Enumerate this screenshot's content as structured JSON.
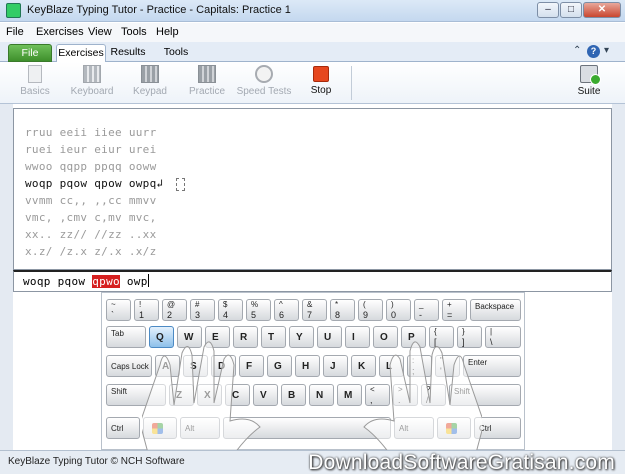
{
  "window": {
    "title": "KeyBlaze Typing Tutor - Practice - Capitals: Practice 1",
    "controls": {
      "minimize": "–",
      "maximize": "□",
      "close": "✕"
    }
  },
  "menu": [
    "File",
    "Exercises",
    "View",
    "Tools",
    "Help"
  ],
  "tabs": {
    "file": "File",
    "items": [
      "Exercises",
      "Results",
      "Tools"
    ],
    "active": "Exercises"
  },
  "ribbon": {
    "buttons": [
      {
        "label": "Basics",
        "icon": "basics-icon",
        "enabled": false
      },
      {
        "label": "Keyboard",
        "icon": "keyboard-icon",
        "enabled": false
      },
      {
        "label": "Keypad",
        "icon": "keypad-icon",
        "enabled": false
      },
      {
        "label": "Practice",
        "icon": "practice-icon",
        "enabled": false
      },
      {
        "label": "Speed Tests",
        "icon": "speed-test-icon",
        "enabled": false
      },
      {
        "label": "Stop",
        "icon": "stop-icon",
        "enabled": true
      }
    ],
    "suite": {
      "label": "Suite",
      "icon": "suite-icon",
      "enabled": true
    }
  },
  "practice": {
    "lines": [
      "rruu eeii iiee uurr",
      "ruei ieur eiur urei",
      "wwoo qqpp ppqq ooww",
      "woqp pqow qpow owpq",
      "vvmm cc,, ,,cc mmvv",
      "vmc, ,cmv c,mv mvc,",
      "xx.. zz// //zz ..xx",
      "x.z/ /z.x z/.x .x/z"
    ],
    "current_line": 3,
    "return_symbol": "↲"
  },
  "input": {
    "before": "woqp pqow ",
    "error": "qpwo",
    "after": " owp"
  },
  "keyboard": {
    "row1": [
      [
        "~",
        "`"
      ],
      [
        "!",
        "1"
      ],
      [
        "@",
        "2"
      ],
      [
        "#",
        "3"
      ],
      [
        "$",
        "4"
      ],
      [
        "%",
        "5"
      ],
      [
        "^",
        "6"
      ],
      [
        "&",
        "7"
      ],
      [
        "*",
        "8"
      ],
      [
        "(",
        "9"
      ],
      [
        ")",
        "0"
      ],
      [
        "_",
        "-"
      ],
      [
        "+",
        "="
      ]
    ],
    "row1_backspace": "Backspace",
    "tab": "Tab",
    "row2": [
      "Q",
      "W",
      "E",
      "R",
      "T",
      "Y",
      "U",
      "I",
      "O",
      "P"
    ],
    "row2_brackets": [
      [
        "{",
        "["
      ],
      [
        "}",
        "]"
      ],
      [
        "|",
        "\\"
      ]
    ],
    "caps": "Caps Lock",
    "row3": [
      "A",
      "S",
      "D",
      "F",
      "G",
      "H",
      "J",
      "K",
      "L"
    ],
    "row3_punct": [
      [
        ":",
        ";"
      ],
      [
        "\"",
        "'"
      ]
    ],
    "enter": "Enter",
    "shift_left": "Shift",
    "row4": [
      "Z",
      "X",
      "C",
      "V",
      "B",
      "N",
      "M"
    ],
    "row4_punct": [
      [
        "<",
        ","
      ],
      [
        ">",
        "."
      ],
      [
        "?",
        "/"
      ]
    ],
    "shift_right": "Shift",
    "ctrl_left": "Ctrl",
    "alt_left": "Alt",
    "alt_right": "Alt",
    "ctrl_right": "Ctrl",
    "highlighted_key": "Q"
  },
  "status": {
    "text": "KeyBlaze Typing Tutor © NCH Software",
    "watermark": "DownloadSoftwareGratisan.com"
  },
  "colors": {
    "error_highlight": "#d62020",
    "stop_red": "#e6471e",
    "file_tab_green": "#4fa63a"
  }
}
